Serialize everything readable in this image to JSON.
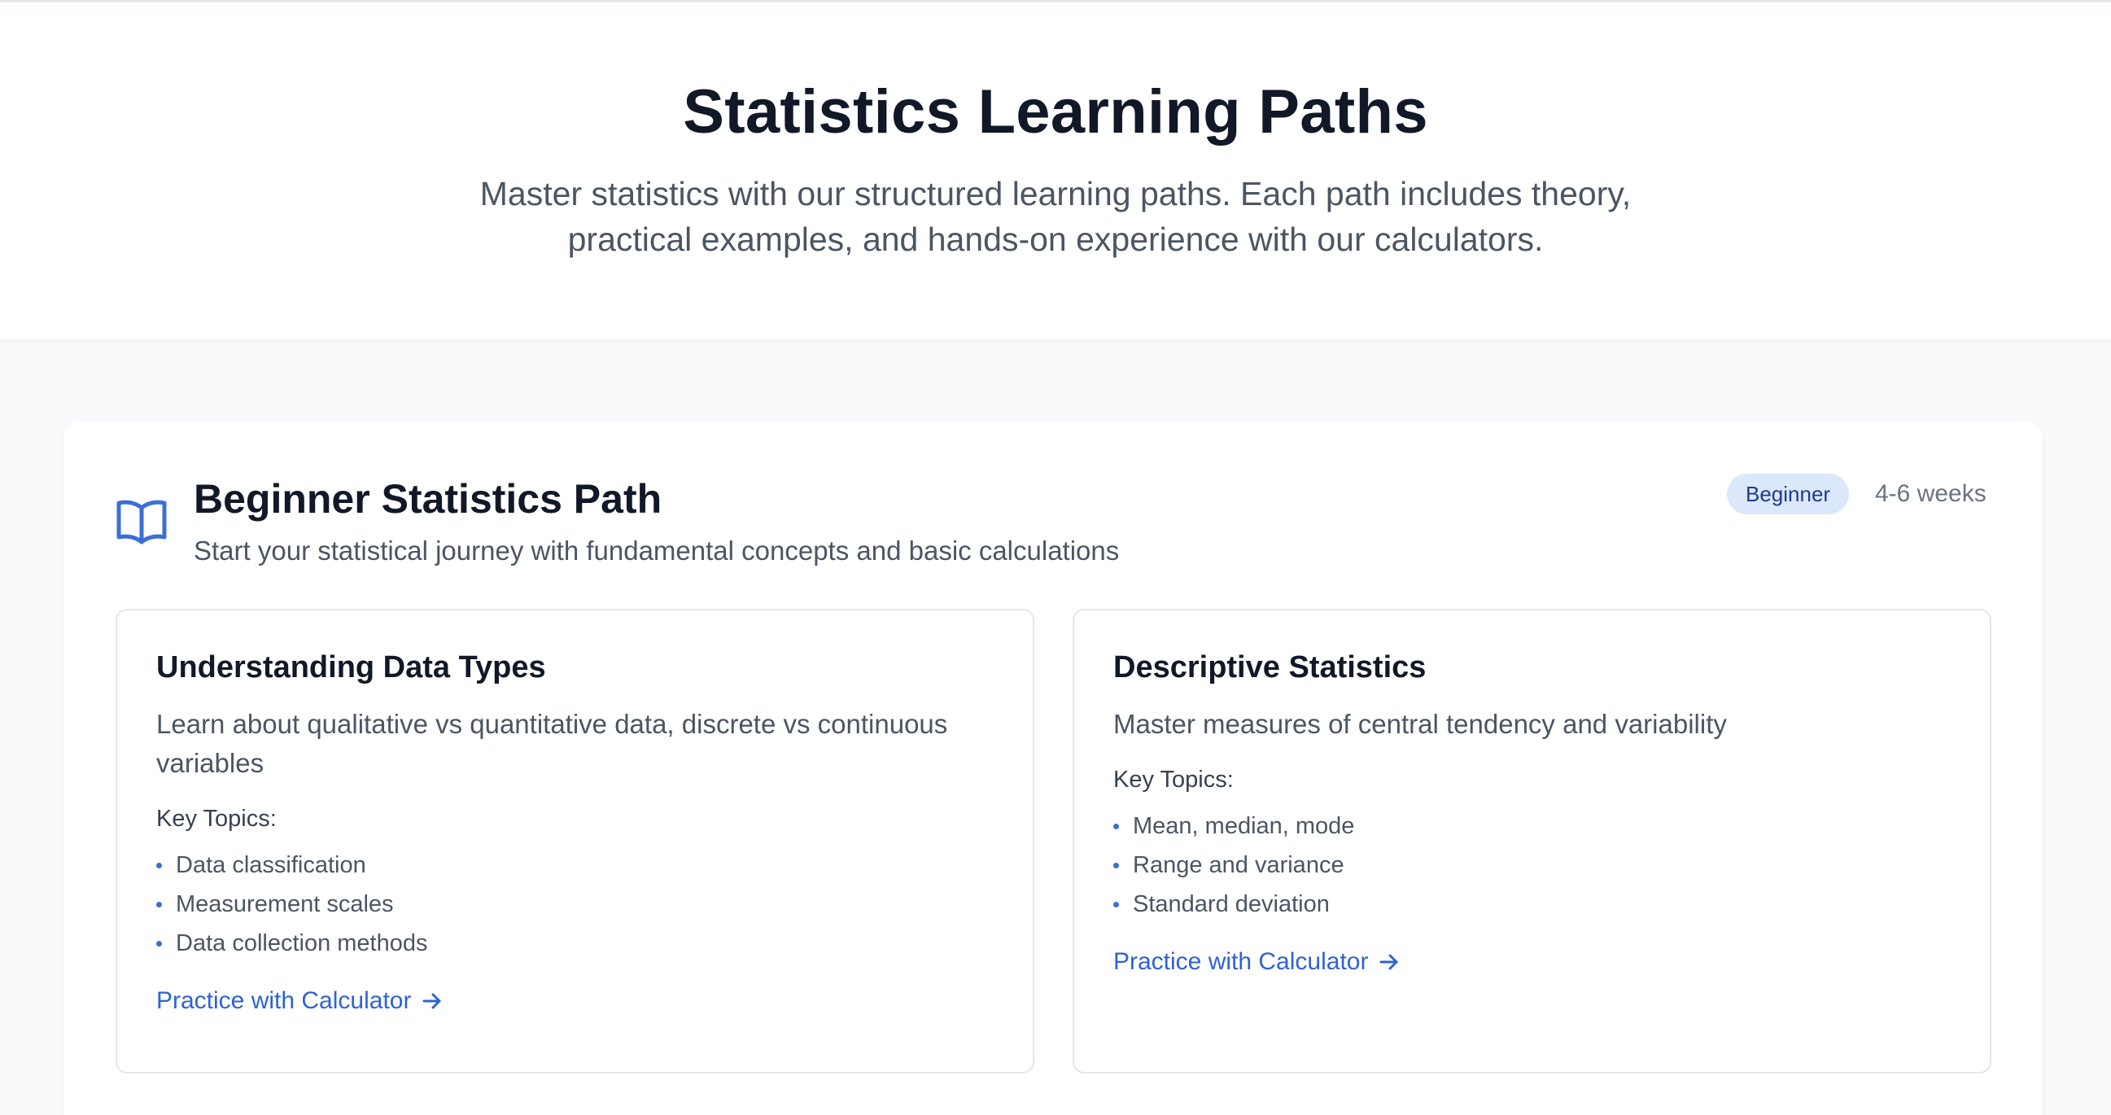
{
  "hero": {
    "title": "Statistics Learning Paths",
    "description": "Master statistics with our structured learning paths. Each path includes theory, practical examples, and hands-on experience with our calculators."
  },
  "path": {
    "icon": "book-open-icon",
    "title": "Beginner Statistics Path",
    "subtitle": "Start your statistical journey with fundamental concepts and basic calculations",
    "level": "Beginner",
    "duration": "4-6 weeks",
    "modules": [
      {
        "title": "Understanding Data Types",
        "description": "Learn about qualitative vs quantitative data, discrete vs continuous variables",
        "topics_label": "Key Topics:",
        "topics": [
          "Data classification",
          "Measurement scales",
          "Data collection methods"
        ],
        "link_label": "Practice with Calculator"
      },
      {
        "title": "Descriptive Statistics",
        "description": "Master measures of central tendency and variability",
        "topics_label": "Key Topics:",
        "topics": [
          "Mean, median, mode",
          "Range and variance",
          "Standard deviation"
        ],
        "link_label": "Practice with Calculator"
      }
    ]
  },
  "colors": {
    "accent": "#2f62d3",
    "badge_bg": "#dbe7fb",
    "badge_text": "#1e3a8a",
    "heading": "#111827",
    "body_text": "#4b5563"
  }
}
